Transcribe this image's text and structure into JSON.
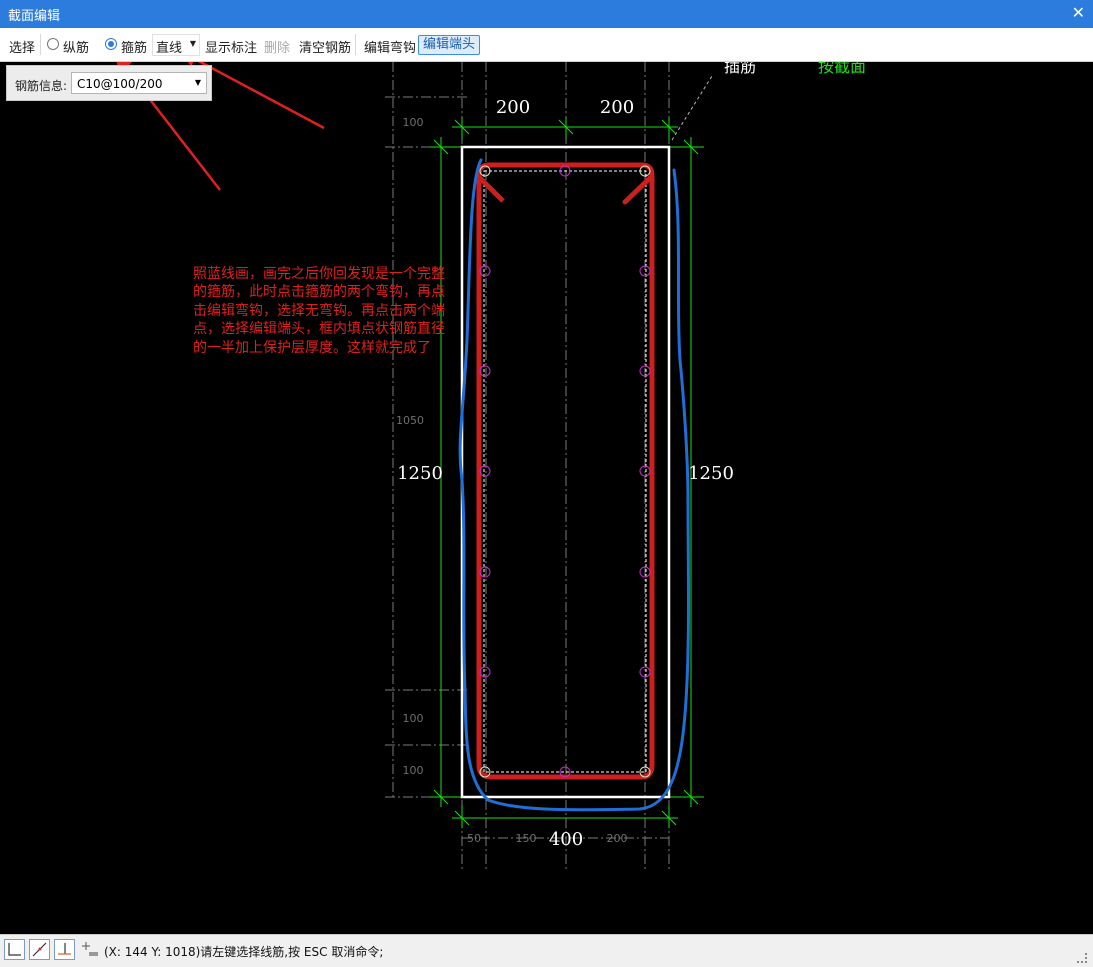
{
  "window": {
    "title": "截面编辑",
    "close_glyph": "✕"
  },
  "toolbar": {
    "select_label": "选择",
    "longitudinal_label": "纵筋",
    "stirrup_label": "箍筋",
    "line_type_value": "直线",
    "show_annotation_label": "显示标注",
    "delete_label": "删除",
    "clear_rebar_label": "清空钢筋",
    "edit_hook_label": "编辑弯钩",
    "edit_end_label": "编辑端头",
    "selected_mode": "stirrup"
  },
  "rebar_info": {
    "label": "钢筋信息:",
    "value": "C10@100/200"
  },
  "drawing": {
    "dims": {
      "top_left": "200",
      "top_right": "200",
      "left_height": "1250",
      "right_height": "1250",
      "bottom_total": "400",
      "bottom_seg1": "50",
      "bottom_seg2": "150",
      "bottom_seg3": "200",
      "side_100_top": "100",
      "side_1050": "1050",
      "side_100_mid": "100",
      "side_100_bot": "100"
    },
    "top_labels": {
      "left": "插筋",
      "right": "按截面"
    },
    "colors": {
      "background": "#000000",
      "section_outline": "#ffffff",
      "dim_lines": "#19e019",
      "stirrup": "#cc2020",
      "freehand": "#1f6fd6",
      "rebar_points": "#c030c0",
      "annotation_arrow": "#e02020"
    }
  },
  "annotation_note": "照蓝线画，画完之后你回发现是一个完整的箍筋，此时点击箍筋的两个弯钩，再点击编辑弯钩，选择无弯钩。再点击两个端点，选择编辑端头，框内填点状钢筋直径的一半加上保护层厚度。这样就完成了",
  "status_bar": {
    "text": "(X: 144 Y: 1018)请左键选择线筋,按 ESC 取消命令;",
    "icons": [
      "ortho-icon",
      "polar-icon",
      "axis-snap-icon",
      "osnap-icon"
    ]
  }
}
